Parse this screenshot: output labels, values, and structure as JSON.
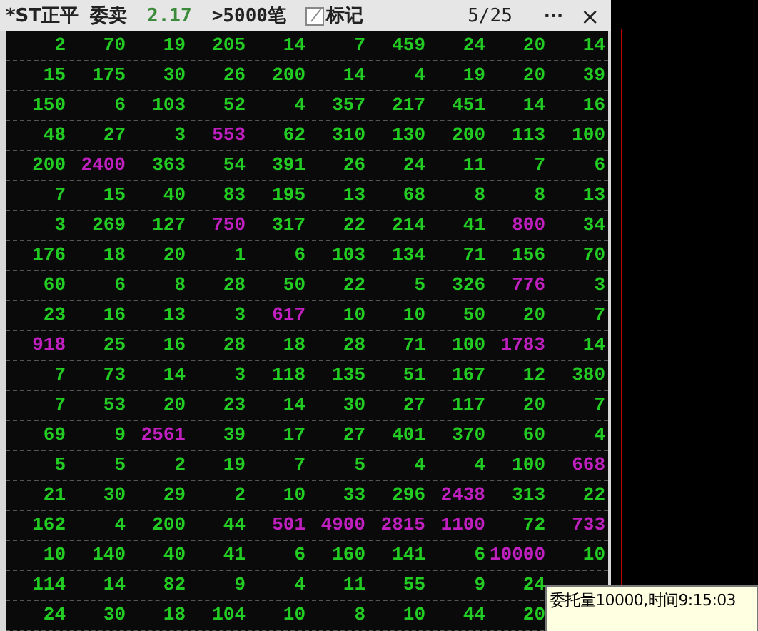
{
  "title_bar": {
    "stock": "*ST正平",
    "side": "委卖",
    "price": "2.17",
    "filter": ">5000笔",
    "mark_label": "标记",
    "page": "5/25",
    "more": "···",
    "close": "×"
  },
  "rows": [
    [
      {
        "v": "2",
        "highlight": false
      },
      {
        "v": "70",
        "highlight": false
      },
      {
        "v": "19",
        "highlight": false
      },
      {
        "v": "205",
        "highlight": false
      },
      {
        "v": "14",
        "highlight": false
      },
      {
        "v": "7",
        "highlight": false
      },
      {
        "v": "459",
        "highlight": false
      },
      {
        "v": "24",
        "highlight": false
      },
      {
        "v": "20",
        "highlight": false
      },
      {
        "v": "14",
        "highlight": false
      }
    ],
    [
      {
        "v": "15",
        "highlight": false
      },
      {
        "v": "175",
        "highlight": false
      },
      {
        "v": "30",
        "highlight": false
      },
      {
        "v": "26",
        "highlight": false
      },
      {
        "v": "200",
        "highlight": false
      },
      {
        "v": "14",
        "highlight": false
      },
      {
        "v": "4",
        "highlight": false
      },
      {
        "v": "19",
        "highlight": false
      },
      {
        "v": "20",
        "highlight": false
      },
      {
        "v": "39",
        "highlight": false
      }
    ],
    [
      {
        "v": "150",
        "highlight": false
      },
      {
        "v": "6",
        "highlight": false
      },
      {
        "v": "103",
        "highlight": false
      },
      {
        "v": "52",
        "highlight": false
      },
      {
        "v": "4",
        "highlight": false
      },
      {
        "v": "357",
        "highlight": false
      },
      {
        "v": "217",
        "highlight": false
      },
      {
        "v": "451",
        "highlight": false
      },
      {
        "v": "14",
        "highlight": false
      },
      {
        "v": "16",
        "highlight": false
      }
    ],
    [
      {
        "v": "48",
        "highlight": false
      },
      {
        "v": "27",
        "highlight": false
      },
      {
        "v": "3",
        "highlight": false
      },
      {
        "v": "553",
        "highlight": true
      },
      {
        "v": "62",
        "highlight": false
      },
      {
        "v": "310",
        "highlight": false
      },
      {
        "v": "130",
        "highlight": false
      },
      {
        "v": "200",
        "highlight": false
      },
      {
        "v": "113",
        "highlight": false
      },
      {
        "v": "100",
        "highlight": false
      }
    ],
    [
      {
        "v": "200",
        "highlight": false
      },
      {
        "v": "2400",
        "highlight": true
      },
      {
        "v": "363",
        "highlight": false
      },
      {
        "v": "54",
        "highlight": false
      },
      {
        "v": "391",
        "highlight": false
      },
      {
        "v": "26",
        "highlight": false
      },
      {
        "v": "24",
        "highlight": false
      },
      {
        "v": "11",
        "highlight": false
      },
      {
        "v": "7",
        "highlight": false
      },
      {
        "v": "6",
        "highlight": false
      }
    ],
    [
      {
        "v": "7",
        "highlight": false
      },
      {
        "v": "15",
        "highlight": false
      },
      {
        "v": "40",
        "highlight": false
      },
      {
        "v": "83",
        "highlight": false
      },
      {
        "v": "195",
        "highlight": false
      },
      {
        "v": "13",
        "highlight": false
      },
      {
        "v": "68",
        "highlight": false
      },
      {
        "v": "8",
        "highlight": false
      },
      {
        "v": "8",
        "highlight": false
      },
      {
        "v": "13",
        "highlight": false
      }
    ],
    [
      {
        "v": "3",
        "highlight": false
      },
      {
        "v": "269",
        "highlight": false
      },
      {
        "v": "127",
        "highlight": false
      },
      {
        "v": "750",
        "highlight": true
      },
      {
        "v": "317",
        "highlight": false
      },
      {
        "v": "22",
        "highlight": false
      },
      {
        "v": "214",
        "highlight": false
      },
      {
        "v": "41",
        "highlight": false
      },
      {
        "v": "800",
        "highlight": true
      },
      {
        "v": "34",
        "highlight": false
      }
    ],
    [
      {
        "v": "176",
        "highlight": false
      },
      {
        "v": "18",
        "highlight": false
      },
      {
        "v": "20",
        "highlight": false
      },
      {
        "v": "1",
        "highlight": false
      },
      {
        "v": "6",
        "highlight": false
      },
      {
        "v": "103",
        "highlight": false
      },
      {
        "v": "134",
        "highlight": false
      },
      {
        "v": "71",
        "highlight": false
      },
      {
        "v": "156",
        "highlight": false
      },
      {
        "v": "70",
        "highlight": false
      }
    ],
    [
      {
        "v": "60",
        "highlight": false
      },
      {
        "v": "6",
        "highlight": false
      },
      {
        "v": "8",
        "highlight": false
      },
      {
        "v": "28",
        "highlight": false
      },
      {
        "v": "50",
        "highlight": false
      },
      {
        "v": "22",
        "highlight": false
      },
      {
        "v": "5",
        "highlight": false
      },
      {
        "v": "326",
        "highlight": false
      },
      {
        "v": "776",
        "highlight": true
      },
      {
        "v": "3",
        "highlight": false
      }
    ],
    [
      {
        "v": "23",
        "highlight": false
      },
      {
        "v": "16",
        "highlight": false
      },
      {
        "v": "13",
        "highlight": false
      },
      {
        "v": "3",
        "highlight": false
      },
      {
        "v": "617",
        "highlight": true
      },
      {
        "v": "10",
        "highlight": false
      },
      {
        "v": "10",
        "highlight": false
      },
      {
        "v": "50",
        "highlight": false
      },
      {
        "v": "20",
        "highlight": false
      },
      {
        "v": "7",
        "highlight": false
      }
    ],
    [
      {
        "v": "918",
        "highlight": true
      },
      {
        "v": "25",
        "highlight": false
      },
      {
        "v": "16",
        "highlight": false
      },
      {
        "v": "28",
        "highlight": false
      },
      {
        "v": "18",
        "highlight": false
      },
      {
        "v": "28",
        "highlight": false
      },
      {
        "v": "71",
        "highlight": false
      },
      {
        "v": "100",
        "highlight": false
      },
      {
        "v": "1783",
        "highlight": true
      },
      {
        "v": "14",
        "highlight": false
      }
    ],
    [
      {
        "v": "7",
        "highlight": false
      },
      {
        "v": "73",
        "highlight": false
      },
      {
        "v": "14",
        "highlight": false
      },
      {
        "v": "3",
        "highlight": false
      },
      {
        "v": "118",
        "highlight": false
      },
      {
        "v": "135",
        "highlight": false
      },
      {
        "v": "51",
        "highlight": false
      },
      {
        "v": "167",
        "highlight": false
      },
      {
        "v": "12",
        "highlight": false
      },
      {
        "v": "380",
        "highlight": false
      }
    ],
    [
      {
        "v": "7",
        "highlight": false
      },
      {
        "v": "53",
        "highlight": false
      },
      {
        "v": "20",
        "highlight": false
      },
      {
        "v": "23",
        "highlight": false
      },
      {
        "v": "14",
        "highlight": false
      },
      {
        "v": "30",
        "highlight": false
      },
      {
        "v": "27",
        "highlight": false
      },
      {
        "v": "117",
        "highlight": false
      },
      {
        "v": "20",
        "highlight": false
      },
      {
        "v": "7",
        "highlight": false
      }
    ],
    [
      {
        "v": "69",
        "highlight": false
      },
      {
        "v": "9",
        "highlight": false
      },
      {
        "v": "2561",
        "highlight": true
      },
      {
        "v": "39",
        "highlight": false
      },
      {
        "v": "17",
        "highlight": false
      },
      {
        "v": "27",
        "highlight": false
      },
      {
        "v": "401",
        "highlight": false
      },
      {
        "v": "370",
        "highlight": false
      },
      {
        "v": "60",
        "highlight": false
      },
      {
        "v": "4",
        "highlight": false
      }
    ],
    [
      {
        "v": "5",
        "highlight": false
      },
      {
        "v": "5",
        "highlight": false
      },
      {
        "v": "2",
        "highlight": false
      },
      {
        "v": "19",
        "highlight": false
      },
      {
        "v": "7",
        "highlight": false
      },
      {
        "v": "5",
        "highlight": false
      },
      {
        "v": "4",
        "highlight": false
      },
      {
        "v": "4",
        "highlight": false
      },
      {
        "v": "100",
        "highlight": false
      },
      {
        "v": "668",
        "highlight": true
      }
    ],
    [
      {
        "v": "21",
        "highlight": false
      },
      {
        "v": "30",
        "highlight": false
      },
      {
        "v": "29",
        "highlight": false
      },
      {
        "v": "2",
        "highlight": false
      },
      {
        "v": "10",
        "highlight": false
      },
      {
        "v": "33",
        "highlight": false
      },
      {
        "v": "296",
        "highlight": false
      },
      {
        "v": "2438",
        "highlight": true
      },
      {
        "v": "313",
        "highlight": false
      },
      {
        "v": "22",
        "highlight": false
      }
    ],
    [
      {
        "v": "162",
        "highlight": false
      },
      {
        "v": "4",
        "highlight": false
      },
      {
        "v": "200",
        "highlight": false
      },
      {
        "v": "44",
        "highlight": false
      },
      {
        "v": "501",
        "highlight": true
      },
      {
        "v": "4900",
        "highlight": true
      },
      {
        "v": "2815",
        "highlight": true
      },
      {
        "v": "1100",
        "highlight": true
      },
      {
        "v": "72",
        "highlight": false
      },
      {
        "v": "733",
        "highlight": true
      }
    ],
    [
      {
        "v": "10",
        "highlight": false
      },
      {
        "v": "140",
        "highlight": false
      },
      {
        "v": "40",
        "highlight": false
      },
      {
        "v": "41",
        "highlight": false
      },
      {
        "v": "6",
        "highlight": false
      },
      {
        "v": "160",
        "highlight": false
      },
      {
        "v": "141",
        "highlight": false
      },
      {
        "v": "6",
        "highlight": false
      },
      {
        "v": "10000",
        "highlight": true
      },
      {
        "v": "10",
        "highlight": false
      }
    ],
    [
      {
        "v": "114",
        "highlight": false
      },
      {
        "v": "14",
        "highlight": false
      },
      {
        "v": "82",
        "highlight": false
      },
      {
        "v": "9",
        "highlight": false
      },
      {
        "v": "4",
        "highlight": false
      },
      {
        "v": "11",
        "highlight": false
      },
      {
        "v": "55",
        "highlight": false
      },
      {
        "v": "9",
        "highlight": false
      },
      {
        "v": "24",
        "highlight": false
      }
    ],
    [
      {
        "v": "24",
        "highlight": false
      },
      {
        "v": "30",
        "highlight": false
      },
      {
        "v": "18",
        "highlight": false
      },
      {
        "v": "104",
        "highlight": false
      },
      {
        "v": "10",
        "highlight": false
      },
      {
        "v": "8",
        "highlight": false
      },
      {
        "v": "10",
        "highlight": false
      },
      {
        "v": "44",
        "highlight": false
      },
      {
        "v": "20",
        "highlight": false
      }
    ]
  ],
  "tooltip": [
    "委托量10000,时间9:15:03"
  ]
}
